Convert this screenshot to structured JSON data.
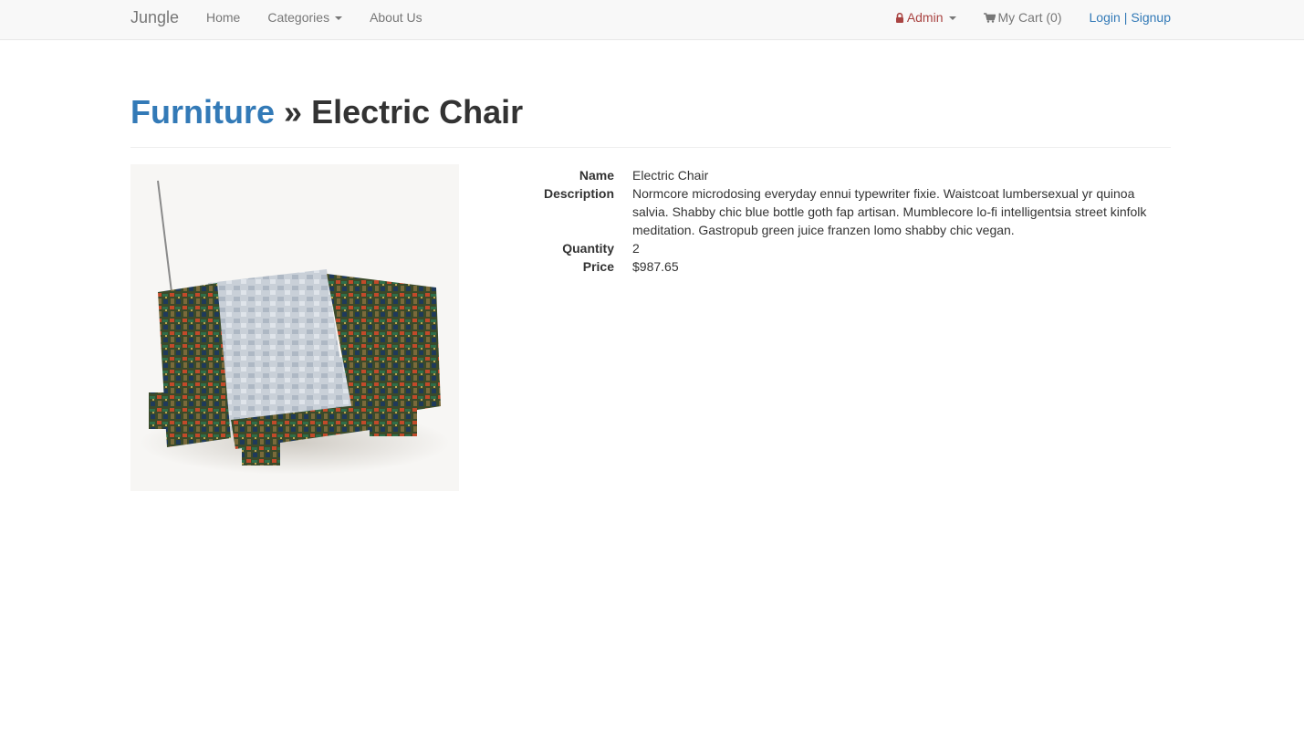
{
  "navbar": {
    "brand": "Jungle",
    "home": "Home",
    "categories": "Categories",
    "about": "About Us",
    "admin": "Admin",
    "cart": "My Cart (0)",
    "login": "Login",
    "separator": "|",
    "signup": "Signup"
  },
  "header": {
    "category": "Furniture",
    "separator": "»",
    "product": "Electric Chair"
  },
  "details": {
    "name_label": "Name",
    "name": "Electric Chair",
    "description_label": "Description",
    "description": "Normcore microdosing everyday ennui typewriter fixie. Waistcoat lumbersexual yr quinoa salvia. Shabby chic blue bottle goth fap artisan. Mumblecore lo-fi intelligentsia street kinfolk meditation. Gastropub green juice franzen lomo shabby chic vegan.",
    "quantity_label": "Quantity",
    "quantity": "2",
    "price_label": "Price",
    "price": "$987.65"
  },
  "colors": {
    "link": "#337ab7",
    "admin": "#a94442",
    "navbar_bg": "#f8f8f8",
    "text": "#333333"
  },
  "icons": {
    "admin": "lock-icon",
    "cart": "shopping-cart-icon"
  }
}
